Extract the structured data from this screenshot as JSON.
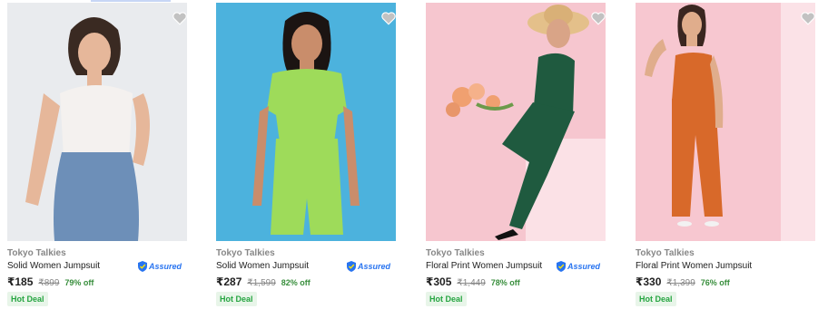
{
  "products": [
    {
      "brand": "Tokyo Talkies",
      "title": "Solid Women Jumpsuit",
      "assured": true,
      "assured_label": "Assured",
      "price": "₹185",
      "mrp": "₹899",
      "discount": "79% off",
      "badge": "Hot Deal",
      "bg_color": "#e9ebee",
      "outfit_color": "#6d8fb8",
      "image": "product-photo"
    },
    {
      "brand": "Tokyo Talkies",
      "title": "Solid Women Jumpsuit",
      "assured": true,
      "assured_label": "Assured",
      "price": "₹287",
      "mrp": "₹1,599",
      "discount": "82% off",
      "badge": "Hot Deal",
      "bg_color": "#4cb2dd",
      "outfit_color": "#9edb5a",
      "image": "product-photo"
    },
    {
      "brand": "Tokyo Talkies",
      "title": "Floral Print Women Jumpsuit",
      "assured": true,
      "assured_label": "Assured",
      "price": "₹305",
      "mrp": "₹1,449",
      "discount": "78% off",
      "badge": "Hot Deal",
      "bg_color": "#f6c6cf",
      "outfit_color": "#1f5a3f",
      "image": "product-photo"
    },
    {
      "brand": "Tokyo Talkies",
      "title": "Floral Print Women Jumpsuit",
      "assured": false,
      "assured_label": "",
      "price": "₹330",
      "mrp": "₹1,399",
      "discount": "76% off",
      "badge": "Hot Deal",
      "bg_color": "#f7c7d0",
      "outfit_color": "#d8692a",
      "image": "product-photo"
    }
  ],
  "colors": {
    "wishlist_heart": "#c2c2c2",
    "discount_green": "#388e3c",
    "assured_blue": "#2874f0",
    "hot_deal_bg": "#e8f5e9"
  },
  "icons": {
    "wishlist": "heart-icon",
    "assured": "assured-shield-icon"
  }
}
